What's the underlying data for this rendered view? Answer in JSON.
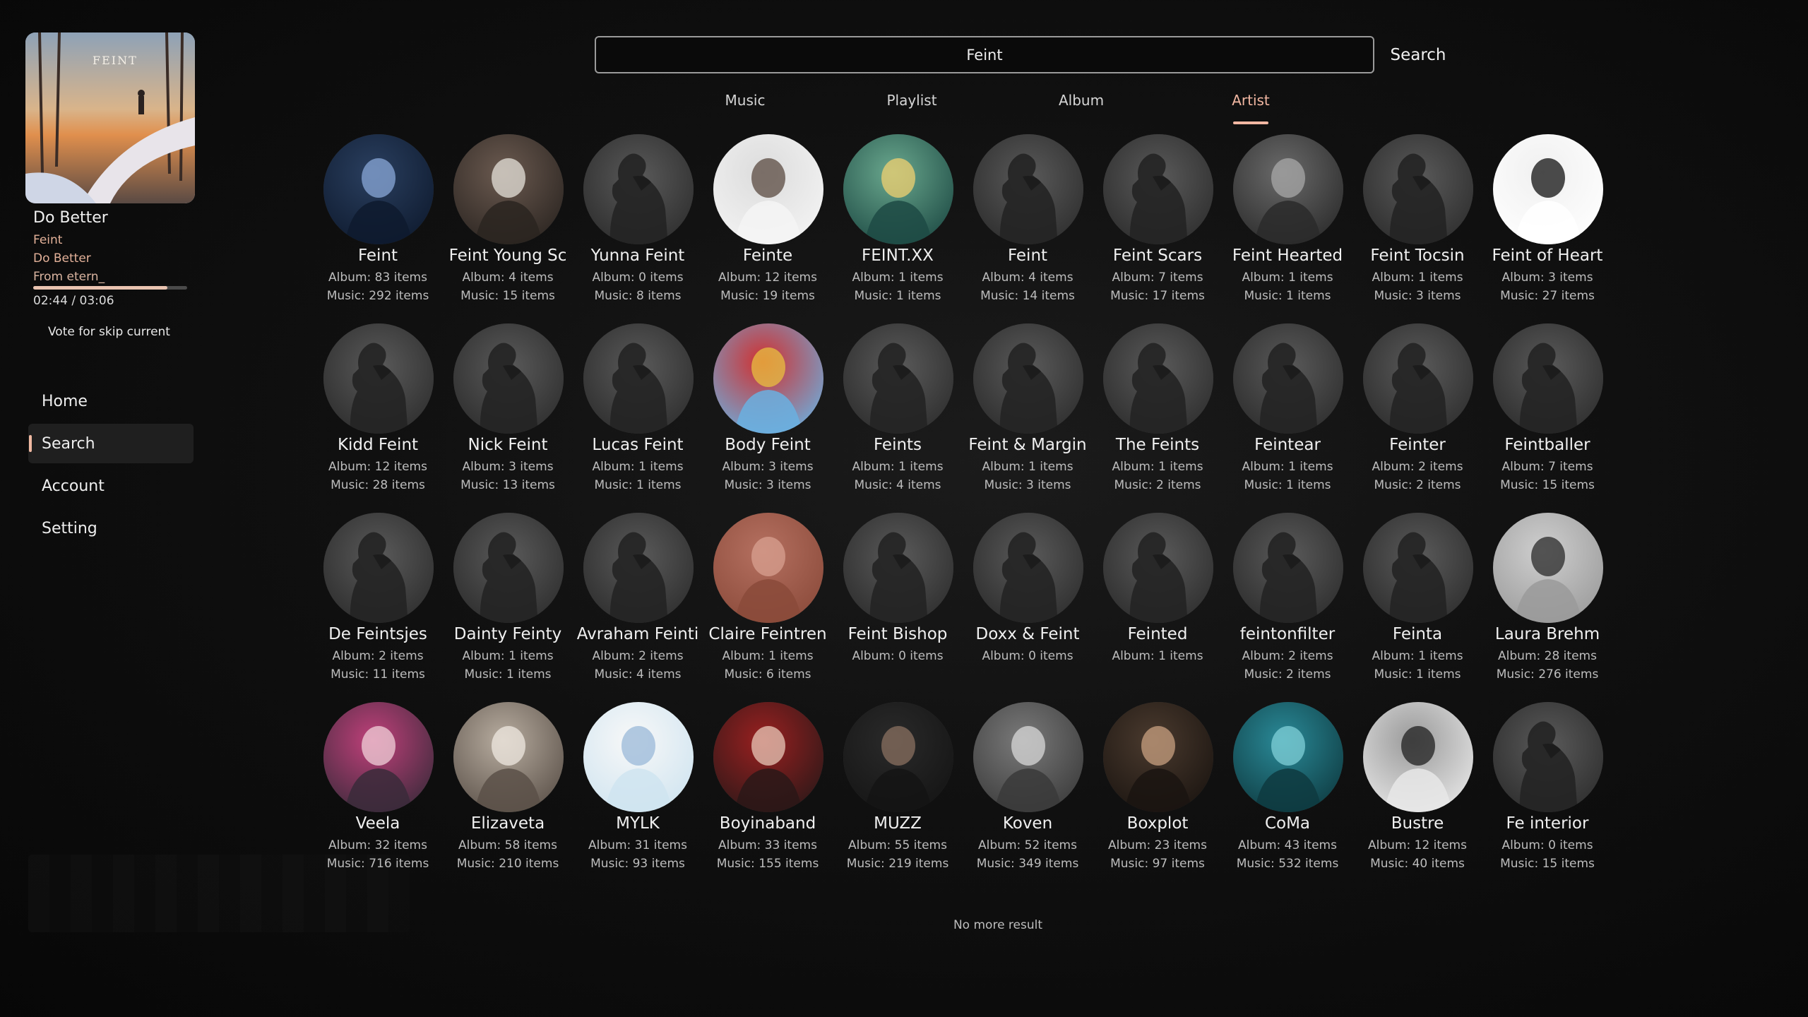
{
  "now_playing": {
    "title": "Do Better",
    "artist": "Feint",
    "album": "Do Better",
    "from": "From etern_",
    "time": "02:44 / 03:06",
    "progress": 0.87,
    "vote_label": "Vote for skip current",
    "cover_text": "FEINT"
  },
  "nav": {
    "items": [
      "Home",
      "Search",
      "Account",
      "Setting"
    ],
    "active": "Search"
  },
  "search": {
    "value": "Feint",
    "button": "Search"
  },
  "tabs": {
    "items": [
      "Music",
      "Playlist",
      "Album",
      "Artist"
    ],
    "active": "Artist"
  },
  "artists": [
    {
      "name": "Feint",
      "album": "Album: 83 items",
      "music": "Music: 292 items",
      "img": "photo-dark-blue"
    },
    {
      "name": "Feint Young Sc",
      "album": "Album: 4 items",
      "music": "Music: 15 items",
      "img": "large-record"
    },
    {
      "name": "Yunna Feint",
      "album": "Album: 0 items",
      "music": "Music: 8 items",
      "img": "silhouette"
    },
    {
      "name": "Feinte",
      "album": "Album: 12 items",
      "music": "Music: 19 items",
      "img": "photo-white"
    },
    {
      "name": "FEINT.XX",
      "album": "Album: 1 items",
      "music": "Music: 1 items",
      "img": "photo-teal"
    },
    {
      "name": "Feint",
      "album": "Album: 4 items",
      "music": "Music: 14 items",
      "img": "silhouette"
    },
    {
      "name": "Feint Scars",
      "album": "Album: 7 items",
      "music": "Music: 17 items",
      "img": "silhouette"
    },
    {
      "name": "Feint Hearted",
      "album": "Album: 1 items",
      "music": "Music: 1 items",
      "img": "photo-gray"
    },
    {
      "name": "Feint Tocsin",
      "album": "Album: 1 items",
      "music": "Music: 3 items",
      "img": "silhouette"
    },
    {
      "name": "Feint of Heart",
      "album": "Album: 3 items",
      "music": "Music: 27 items",
      "img": "photo-white-figure"
    },
    {
      "name": "Kidd Feint",
      "album": "Album: 12 items",
      "music": "Music: 28 items",
      "img": "silhouette"
    },
    {
      "name": "Nick Feint",
      "album": "Album: 3 items",
      "music": "Music: 13 items",
      "img": "silhouette"
    },
    {
      "name": "Lucas Feint",
      "album": "Album: 1 items",
      "music": "Music: 1 items",
      "img": "silhouette"
    },
    {
      "name": "Body Feint",
      "album": "Album: 3 items",
      "music": "Music: 3 items",
      "img": "photo-red-sky"
    },
    {
      "name": "Feints",
      "album": "Album: 1 items",
      "music": "Music: 4 items",
      "img": "silhouette"
    },
    {
      "name": "Feint & Margin",
      "album": "Album: 1 items",
      "music": "Music: 3 items",
      "img": "silhouette"
    },
    {
      "name": "The Feints",
      "album": "Album: 1 items",
      "music": "Music: 2 items",
      "img": "silhouette"
    },
    {
      "name": "Feintear",
      "album": "Album: 1 items",
      "music": "Music: 1 items",
      "img": "silhouette"
    },
    {
      "name": "Feinter",
      "album": "Album: 2 items",
      "music": "Music: 2 items",
      "img": "silhouette"
    },
    {
      "name": "Feintballer",
      "album": "Album: 7 items",
      "music": "Music: 15 items",
      "img": "silhouette"
    },
    {
      "name": "De Feintsjes",
      "album": "Album: 2 items",
      "music": "Music: 11 items",
      "img": "silhouette"
    },
    {
      "name": "Dainty Feinty",
      "album": "Album: 1 items",
      "music": "Music: 1 items",
      "img": "silhouette"
    },
    {
      "name": "Avraham Feinti",
      "album": "Album: 2 items",
      "music": "Music: 4 items",
      "img": "silhouette"
    },
    {
      "name": "Claire Feintren",
      "album": "Album: 1 items",
      "music": "Music: 6 items",
      "img": "photo-copper"
    },
    {
      "name": "Feint Bishop",
      "album": "Album: 0 items",
      "music": "",
      "img": "silhouette"
    },
    {
      "name": "Doxx & Feint",
      "album": "Album: 0 items",
      "music": "",
      "img": "silhouette"
    },
    {
      "name": "Feinted",
      "album": "Album: 1 items",
      "music": "",
      "img": "silhouette"
    },
    {
      "name": "feintonfilter",
      "album": "Album: 2 items",
      "music": "Music: 2 items",
      "img": "silhouette"
    },
    {
      "name": "Feinta",
      "album": "Album: 1 items",
      "music": "Music: 1 items",
      "img": "silhouette"
    },
    {
      "name": "Laura Brehm",
      "album": "Album: 28 items",
      "music": "Music: 276 items",
      "img": "photo-guitar"
    },
    {
      "name": "Veela",
      "album": "Album: 32 items",
      "music": "Music: 716 items",
      "img": "photo-pink-hair"
    },
    {
      "name": "Elizaveta",
      "album": "Album: 58 items",
      "music": "Music: 210 items",
      "img": "photo-flowers"
    },
    {
      "name": "MYLK",
      "album": "Album: 31 items",
      "music": "Music: 93 items",
      "img": "photo-light-blue"
    },
    {
      "name": "Boyinaband",
      "album": "Album: 33 items",
      "music": "Music: 155 items",
      "img": "photo-red-hair"
    },
    {
      "name": "MUZZ",
      "album": "Album: 55 items",
      "music": "Music: 219 items",
      "img": "photo-dark"
    },
    {
      "name": "Koven",
      "album": "Album: 52 items",
      "music": "Music: 349 items",
      "img": "photo-duo"
    },
    {
      "name": "Boxplot",
      "album": "Album: 23 items",
      "music": "Music: 97 items",
      "img": "photo-dark-brown"
    },
    {
      "name": "CoMa",
      "album": "Album: 43 items",
      "music": "Music: 532 items",
      "img": "photo-cyan"
    },
    {
      "name": "Bustre",
      "album": "Album: 12 items",
      "music": "Music: 40 items",
      "img": "photo-bw"
    },
    {
      "name": "Fe interior",
      "album": "Album: 0 items",
      "music": "Music: 15 items",
      "img": "silhouette"
    }
  ],
  "no_more": "No more result",
  "colors": {
    "accent": "#f2b7a2",
    "background": "#0d0d0d",
    "text": "#f0f0f0",
    "muted": "#bdbdbd"
  }
}
